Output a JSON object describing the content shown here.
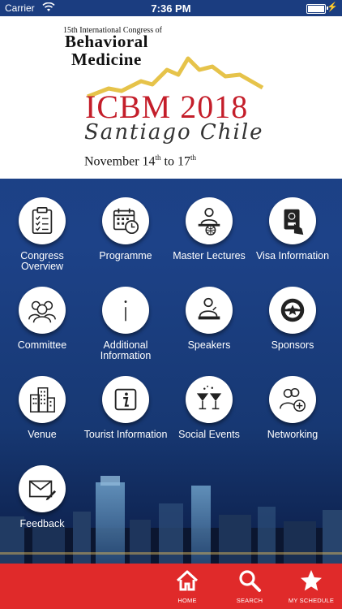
{
  "status_bar": {
    "carrier": "Carrier",
    "time": "7:36 PM"
  },
  "header": {
    "congress_line": "15th International Congress of",
    "title_line1": "Behavioral",
    "title_line2": "Medicine",
    "acronym": "ICBM 2018",
    "city": "Santiago Chile",
    "dates_prefix": "November 14",
    "dates_sup1": "th",
    "dates_mid": " to 17",
    "dates_sup2": "th",
    "accent_color": "#c41e2a",
    "mountain_color": "#e6c34a"
  },
  "menu": {
    "congress_overview": "Congress Overview",
    "programme": "Programme",
    "master_lectures": "Master Lectures",
    "visa_information": "Visa Information",
    "committee": "Committee",
    "additional_information": "Additional Information",
    "speakers": "Speakers",
    "sponsors": "Sponsors",
    "venue": "Venue",
    "tourist_information": "Tourist Information",
    "social_events": "Social Events",
    "networking": "Networking",
    "feedback": "Feedback"
  },
  "tabbar": {
    "color": "#e02a2a",
    "home": "HOME",
    "search": "SEARCH",
    "my_schedule": "MY SCHEDULE"
  }
}
